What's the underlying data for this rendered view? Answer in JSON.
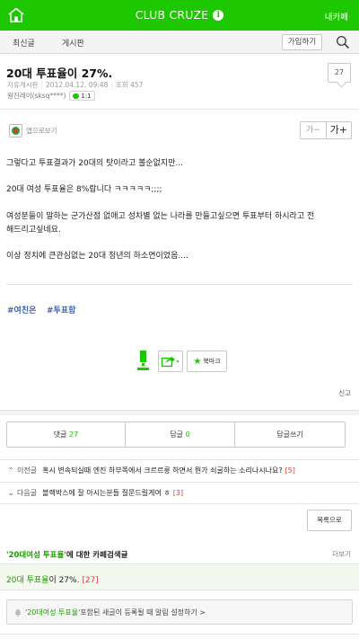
{
  "topbar": {
    "title": "CLUB CRUZE",
    "info_icon_glyph": "i",
    "my_cafe_label": "내카페",
    "color": "#1ec800"
  },
  "subnav": {
    "tab_recent": "최신글",
    "tab_board": "게시판",
    "join_label": "가입하기"
  },
  "post": {
    "title": "20대 투표율이 27%.",
    "board": "자유게시판",
    "date": "2012.04.12. 09:48",
    "views": "조회 457",
    "author": "왕진레이(sksq****)",
    "chat_label": "1:1",
    "comment_count": "27",
    "app_view_label": "앱으로보기",
    "font_minus": "가−",
    "font_plus": "가+",
    "paragraphs": [
      "그렇다고 투표결과가 20대의 탓이라고 볼순없지만...",
      "20대 여성 투표율은 8%랍니다 ㅋㅋㅋㅋㅋ;;;;",
      "여성분들이 말하는 군가산점 없애고 성차별 없는 나라를 만들고싶으면 투표부터 하시라고 전",
      "해드리고싶네요.",
      "이상 정치에 큰관심없는 20대 청년의 하소연이었음...."
    ],
    "tags": [
      "#여친은",
      "#투표함"
    ],
    "bookmark_label": "북마크",
    "report_label": "신고"
  },
  "actions": {
    "comment_label": "댓글",
    "comment_count": "27",
    "reply_label": "답글",
    "reply_count": "0",
    "write_reply_label": "답글쓰기"
  },
  "prev_post": {
    "label": "이전글",
    "title": "혹시 변속되실때 엔진 하부쪽에서 크르르릉 하면서 뭔가 쇠굴하는 소리나시나요?",
    "count": "[5]"
  },
  "next_post": {
    "label": "다음글",
    "title": "블랙박스에 잘 아시는분들 질문드릴게여 ㅎ",
    "count": "[3]"
  },
  "list_button": "목록으로",
  "related": {
    "keyword": "'20대여성 투표율'",
    "heading_suffix": "에 대한 카페검색글",
    "more_label": "더보기",
    "result_keyword": "20대 투표율",
    "result_rest": "이 27%.",
    "result_count": "[27]",
    "alert_keyword": "'20대여성 투표율'",
    "alert_rest": " 포함된 새글이 등록될 때 알림 설정하기 >"
  }
}
